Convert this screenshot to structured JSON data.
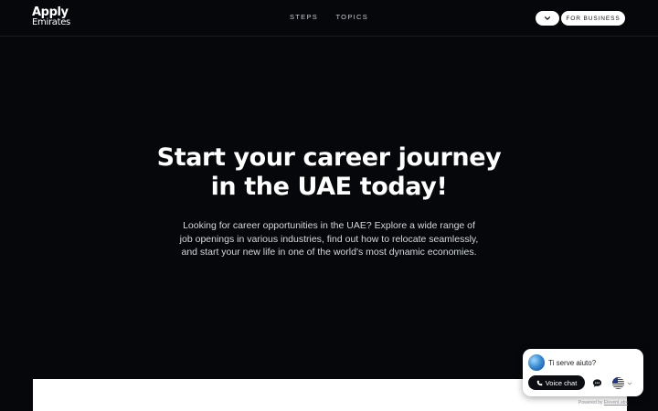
{
  "header": {
    "logo_line1": "Apply",
    "logo_line2": "Emirates",
    "nav": {
      "steps": "STEPS",
      "topics": "TOPICS"
    },
    "business_button": "FOR BUSINESS"
  },
  "hero": {
    "title_line1": "Start your career journey",
    "title_line2": "in the UAE today!",
    "description": "Looking for career opportunities in the UAE? Explore a wide range of job openings in various industries, find out how to relocate seamlessly, and start your new life in one of the world's most dynamic economies."
  },
  "chat_widget": {
    "question": "Ti serve aiuto?",
    "voice_button": "Voice chat",
    "powered_by_prefix": "Powered by",
    "powered_by_link": "ElevenLabs"
  },
  "colors": {
    "background": "#05070b",
    "button_bg": "#ffffff",
    "voice_button_bg": "#0b0d12"
  }
}
